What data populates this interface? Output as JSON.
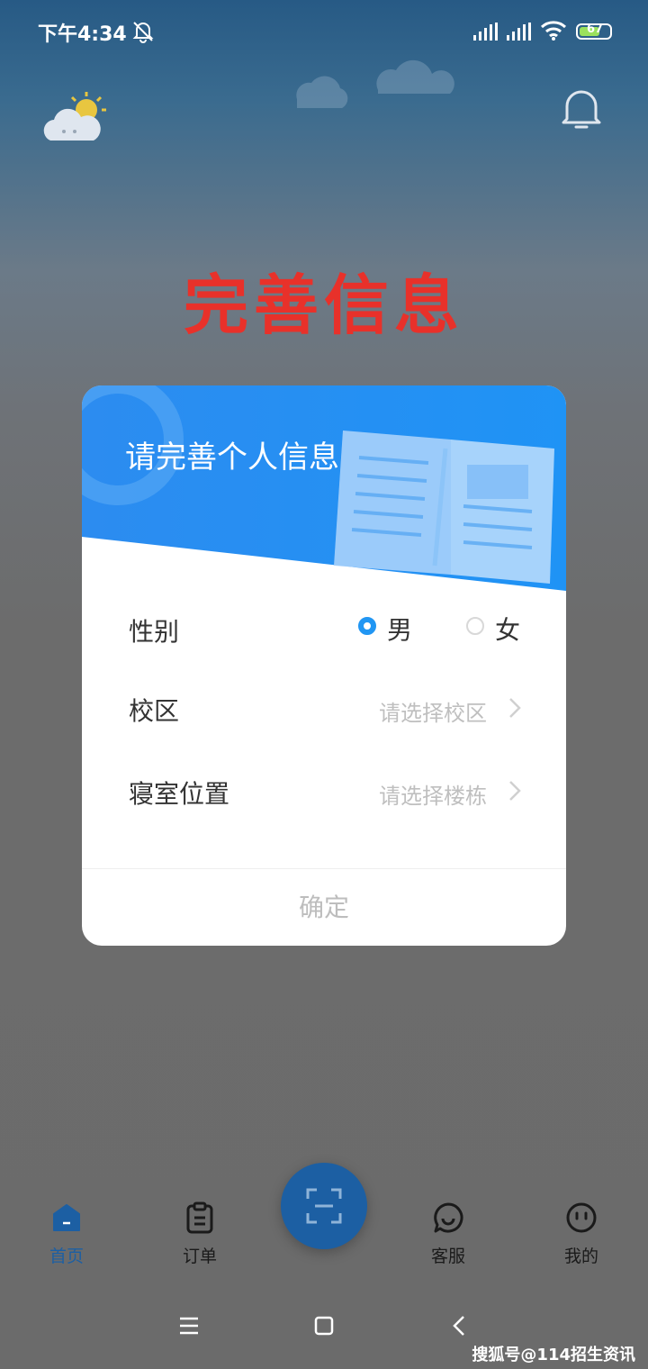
{
  "status_bar": {
    "time": "下午4:34",
    "battery": "67"
  },
  "page": {
    "title": "完善信息"
  },
  "dialog": {
    "header_title": "请完善个人信息",
    "gender": {
      "label": "性别",
      "options": [
        {
          "label": "男",
          "selected": true
        },
        {
          "label": "女",
          "selected": false
        }
      ]
    },
    "campus": {
      "label": "校区",
      "placeholder": "请选择校区"
    },
    "dorm": {
      "label": "寝室位置",
      "placeholder": "请选择楼栋"
    },
    "confirm_label": "确定"
  },
  "nav": {
    "items": [
      {
        "label": "首页",
        "icon": "home-icon",
        "active": true
      },
      {
        "label": "订单",
        "icon": "clipboard-icon",
        "active": false
      },
      {
        "label": "客服",
        "icon": "chat-icon",
        "active": false
      },
      {
        "label": "我的",
        "icon": "face-icon",
        "active": false
      }
    ],
    "scan_icon": "scan-icon"
  },
  "watermark": "搜狐号@114招生资讯",
  "colors": {
    "accent": "#2196f3",
    "title_red": "#e8312a",
    "nav_active": "#1c5fa3"
  }
}
